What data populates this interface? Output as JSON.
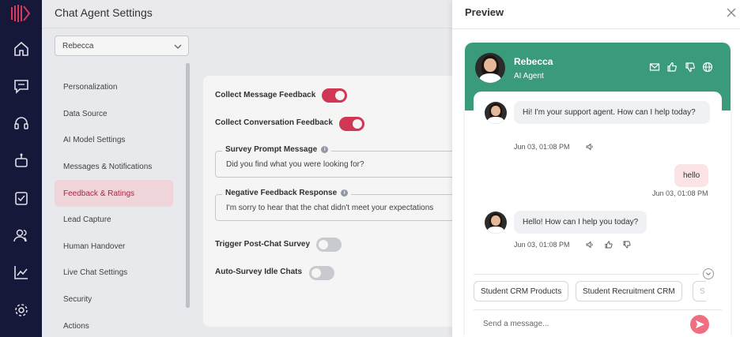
{
  "settings": {
    "title": "Chat Agent Settings",
    "agent_select": "Rebecca",
    "menu": [
      {
        "label": "Personalization",
        "active": false
      },
      {
        "label": "Data Source",
        "active": false
      },
      {
        "label": "AI Model Settings",
        "active": false
      },
      {
        "label": "Messages & Notifications",
        "active": false
      },
      {
        "label": "Feedback & Ratings",
        "active": true
      },
      {
        "label": "Lead Capture",
        "active": false
      },
      {
        "label": "Human Handover",
        "active": false
      },
      {
        "label": "Live Chat Settings",
        "active": false
      },
      {
        "label": "Security",
        "active": false
      },
      {
        "label": "Actions",
        "active": false
      }
    ],
    "feedback": {
      "collect_message_feedback": {
        "label": "Collect Message Feedback",
        "on": true
      },
      "collect_conversation_feedback": {
        "label": "Collect Conversation Feedback",
        "on": true
      },
      "survey_prompt": {
        "label": "Survey Prompt Message",
        "value": "Did you find what you were looking for?"
      },
      "negative_response": {
        "label": "Negative Feedback Response",
        "value": "I'm sorry to hear that the chat didn't meet your expectations"
      },
      "trigger_post_chat": {
        "label": "Trigger Post-Chat Survey",
        "on": false
      },
      "auto_survey_idle": {
        "label": "Auto-Survey Idle Chats",
        "on": false
      }
    }
  },
  "preview": {
    "title": "Preview",
    "agent": {
      "name": "Rebecca",
      "role": "AI Agent"
    },
    "header_icons": [
      "mail-icon",
      "thumbs-up-icon",
      "thumbs-down-icon",
      "globe-icon"
    ],
    "messages": [
      {
        "from": "bot",
        "text": "Hi! I'm your support agent. How can I help today?",
        "time": "Jun 03, 01:08 PM"
      },
      {
        "from": "user",
        "text": "hello",
        "time": "Jun 03, 01:08 PM"
      },
      {
        "from": "bot",
        "text": "Hello! How can I help you today?",
        "time": "Jun 03, 01:08 PM"
      }
    ],
    "suggestions": [
      "Student CRM Products",
      "Student Recruitment CRM",
      "S"
    ],
    "input_placeholder": "Send a message..."
  },
  "colors": {
    "rail": "#161a3b",
    "accent": "#d83a56",
    "chat_header": "#3a9a7c",
    "user_bubble": "#fbe3e6",
    "send_button": "#ef6f80"
  }
}
